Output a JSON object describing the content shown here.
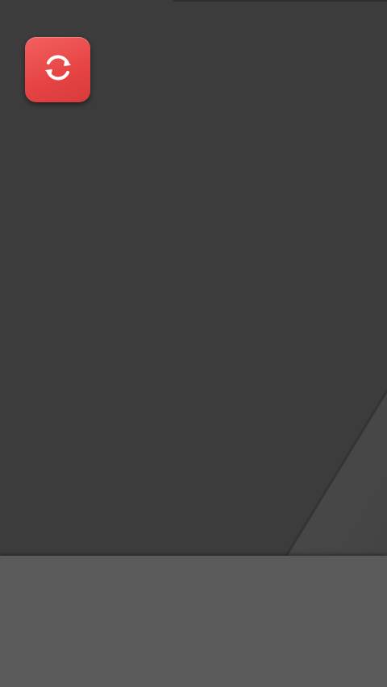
{
  "home_screen": {
    "apps": [
      {
        "label": "",
        "icon": "refresh-icon",
        "color": "#e84545"
      }
    ]
  },
  "colors": {
    "wallpaper": "#3c3c3c",
    "dock": "#5a5a5a",
    "icon_background": "#e84545"
  }
}
